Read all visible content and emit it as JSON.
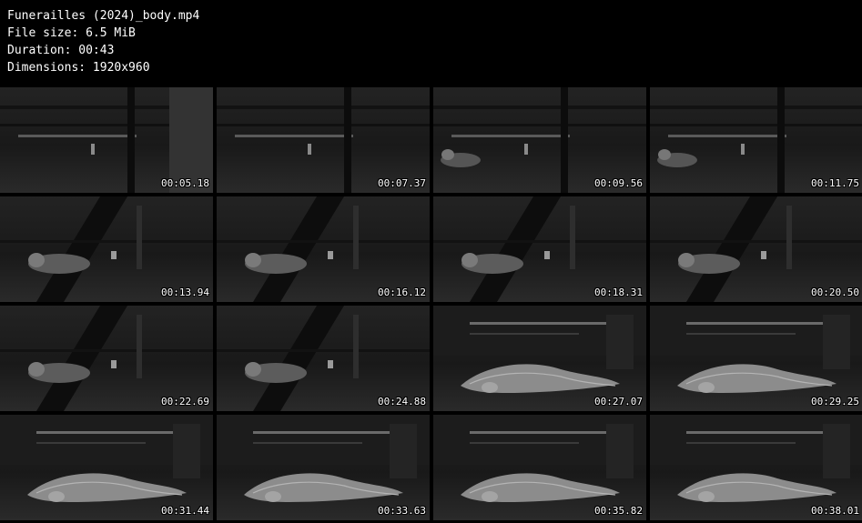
{
  "file_info": {
    "filename": "Funerailles (2024)_body.mp4",
    "file_size": "File size: 6.5 MiB",
    "duration": "Duration: 00:43",
    "dimensions": "Dimensions: 1920x960"
  },
  "thumbnails": [
    {
      "timestamp": "00:05.18",
      "scene": "room-empty"
    },
    {
      "timestamp": "00:07.37",
      "scene": "room-empty"
    },
    {
      "timestamp": "00:09.56",
      "scene": "room-figure-far"
    },
    {
      "timestamp": "00:11.75",
      "scene": "room-figure-far"
    },
    {
      "timestamp": "00:13.94",
      "scene": "figure-mid"
    },
    {
      "timestamp": "00:16.12",
      "scene": "figure-mid"
    },
    {
      "timestamp": "00:18.31",
      "scene": "figure-mid"
    },
    {
      "timestamp": "00:20.50",
      "scene": "figure-mid"
    },
    {
      "timestamp": "00:22.69",
      "scene": "figure-mid"
    },
    {
      "timestamp": "00:24.88",
      "scene": "figure-mid"
    },
    {
      "timestamp": "00:27.07",
      "scene": "figure-close"
    },
    {
      "timestamp": "00:29.25",
      "scene": "figure-close"
    },
    {
      "timestamp": "00:31.44",
      "scene": "figure-close"
    },
    {
      "timestamp": "00:33.63",
      "scene": "figure-close"
    },
    {
      "timestamp": "00:35.82",
      "scene": "figure-close"
    },
    {
      "timestamp": "00:38.01",
      "scene": "figure-close"
    }
  ]
}
